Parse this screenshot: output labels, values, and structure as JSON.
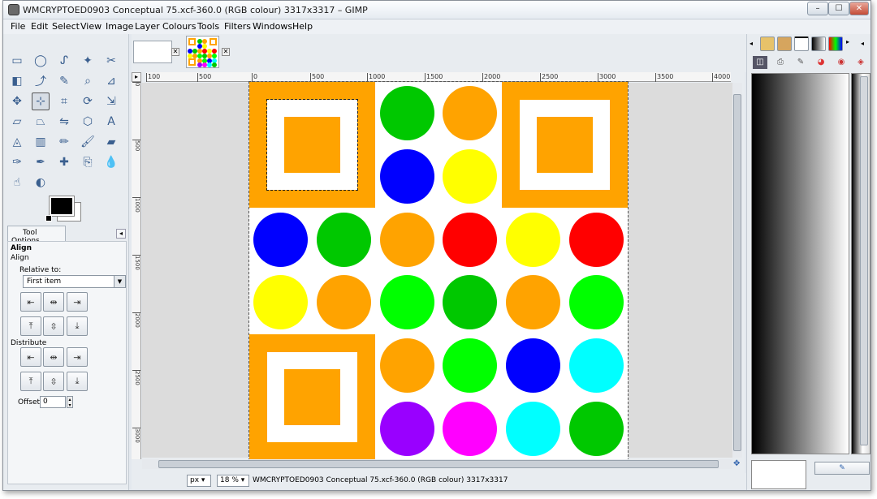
{
  "window": {
    "title": "WMCRYPTOED0903 Conceptual 75.xcf-360.0 (RGB colour) 3317x3317 – GIMP",
    "controls": {
      "minimize": "–",
      "maximize": "☐",
      "close": "✕"
    }
  },
  "menubar": [
    "File",
    "Edit",
    "Select",
    "View",
    "Image",
    "Layer",
    "Colours",
    "Tools",
    "Filters",
    "Windows",
    "Help"
  ],
  "toolbox": {
    "tools": [
      {
        "name": "rect-select-icon",
        "glyph": "▭"
      },
      {
        "name": "ellipse-select-icon",
        "glyph": "◯"
      },
      {
        "name": "free-select-icon",
        "glyph": "ᔑ"
      },
      {
        "name": "fuzzy-select-icon",
        "glyph": "✦"
      },
      {
        "name": "scissors-icon",
        "glyph": "✂"
      },
      {
        "name": "foreground-select-icon",
        "glyph": "◧"
      },
      {
        "name": "paths-icon",
        "glyph": "⤴"
      },
      {
        "name": "color-picker-icon",
        "glyph": "✎"
      },
      {
        "name": "zoom-icon",
        "glyph": "⌕"
      },
      {
        "name": "measure-icon",
        "glyph": "⊿"
      },
      {
        "name": "move-icon",
        "glyph": "✥"
      },
      {
        "name": "align-icon",
        "glyph": "⊹"
      },
      {
        "name": "crop-icon",
        "glyph": "⌗"
      },
      {
        "name": "rotate-icon",
        "glyph": "⟳"
      },
      {
        "name": "scale-icon",
        "glyph": "⇲"
      },
      {
        "name": "shear-icon",
        "glyph": "▱"
      },
      {
        "name": "perspective-icon",
        "glyph": "⏢"
      },
      {
        "name": "flip-icon",
        "glyph": "⇋"
      },
      {
        "name": "cage-icon",
        "glyph": "⬡"
      },
      {
        "name": "text-icon",
        "glyph": "A"
      },
      {
        "name": "bucket-fill-icon",
        "glyph": "◬"
      },
      {
        "name": "blend-icon",
        "glyph": "▥"
      },
      {
        "name": "pencil-icon",
        "glyph": "✏"
      },
      {
        "name": "paintbrush-icon",
        "glyph": "🖌"
      },
      {
        "name": "eraser-icon",
        "glyph": "▰"
      },
      {
        "name": "airbrush-icon",
        "glyph": "✑"
      },
      {
        "name": "ink-icon",
        "glyph": "✒"
      },
      {
        "name": "heal-icon",
        "glyph": "✚"
      },
      {
        "name": "clone-icon",
        "glyph": "⎘"
      },
      {
        "name": "blur-icon",
        "glyph": "💧"
      },
      {
        "name": "smudge-icon",
        "glyph": "☝"
      },
      {
        "name": "dodge-burn-icon",
        "glyph": "◐"
      }
    ],
    "tool_options": {
      "tab_label": "Tool Options",
      "header": "Align",
      "subheader": "Align",
      "relative_to_label": "Relative to:",
      "relative_to_value": "First item",
      "distribute_label": "Distribute",
      "offset_label": "Offset:",
      "offset_value": "0"
    }
  },
  "image_tabs": [
    {
      "name": "blank-image-tab",
      "close": "✕"
    },
    {
      "name": "conceptual-image-tab",
      "close": "✕"
    }
  ],
  "rulers": {
    "horizontal": [
      "|100",
      "|500",
      "|0",
      "|500",
      "|1000",
      "|1500",
      "|2000",
      "|2500",
      "|3000",
      "|3500",
      "|4000"
    ],
    "vertical": [
      "0",
      "500",
      "1000",
      "1500",
      "2000",
      "2500",
      "3000",
      "3500"
    ]
  },
  "image_content": {
    "colors": {
      "orange": "#ffa300",
      "green": "#00c800",
      "bright_green": "#00ff00",
      "blue": "#0000ff",
      "yellow": "#ffff00",
      "red": "#ff0000",
      "cyan": "#00ffff",
      "purple": "#9900ff",
      "magenta": "#ff00ff"
    },
    "circles": [
      {
        "row": 0,
        "col": 2,
        "color": "#00c800"
      },
      {
        "row": 0,
        "col": 3,
        "color": "#ffa300"
      },
      {
        "row": 1,
        "col": 2,
        "color": "#0000ff"
      },
      {
        "row": 1,
        "col": 3,
        "color": "#ffff00"
      },
      {
        "row": 2,
        "col": 0,
        "color": "#0000ff"
      },
      {
        "row": 2,
        "col": 1,
        "color": "#00c800"
      },
      {
        "row": 2,
        "col": 2,
        "color": "#ffa300"
      },
      {
        "row": 2,
        "col": 3,
        "color": "#ff0000"
      },
      {
        "row": 2,
        "col": 4,
        "color": "#ffff00"
      },
      {
        "row": 2,
        "col": 5,
        "color": "#ff0000"
      },
      {
        "row": 3,
        "col": 0,
        "color": "#ffff00"
      },
      {
        "row": 3,
        "col": 1,
        "color": "#ffa300"
      },
      {
        "row": 3,
        "col": 2,
        "color": "#00ff00"
      },
      {
        "row": 3,
        "col": 3,
        "color": "#00c800"
      },
      {
        "row": 3,
        "col": 4,
        "color": "#ffa300"
      },
      {
        "row": 3,
        "col": 5,
        "color": "#00ff00"
      },
      {
        "row": 4,
        "col": 2,
        "color": "#ffa300"
      },
      {
        "row": 4,
        "col": 3,
        "color": "#00ff00"
      },
      {
        "row": 4,
        "col": 4,
        "color": "#0000ff"
      },
      {
        "row": 4,
        "col": 5,
        "color": "#00ffff"
      },
      {
        "row": 5,
        "col": 2,
        "color": "#9900ff"
      },
      {
        "row": 5,
        "col": 3,
        "color": "#ff00ff"
      },
      {
        "row": 5,
        "col": 4,
        "color": "#00ffff"
      },
      {
        "row": 5,
        "col": 5,
        "color": "#00c800"
      }
    ]
  },
  "statusbar": {
    "units": "px",
    "zoom": "18 %",
    "text": "WMCRYPTOED0903 Conceptual 75.xcf-360.0 (RGB colour) 3317x3317"
  },
  "right_dock": {
    "tabs": [
      "brushes-tab",
      "patterns-tab",
      "gradients-active-tab",
      "gradient-bw-tab",
      "palettes-tab"
    ],
    "icons": [
      "document-history-icon",
      "printer-icon",
      "paintbrush-icon",
      "palette-icon",
      "channels-icon",
      "layers-icon"
    ],
    "edit_button_icon": "✎"
  },
  "align_buttons": {
    "left": "⇤",
    "hcenter": "⇹",
    "right": "⇥",
    "top": "⤒",
    "vcenter": "⇳",
    "bottom": "⤓"
  }
}
